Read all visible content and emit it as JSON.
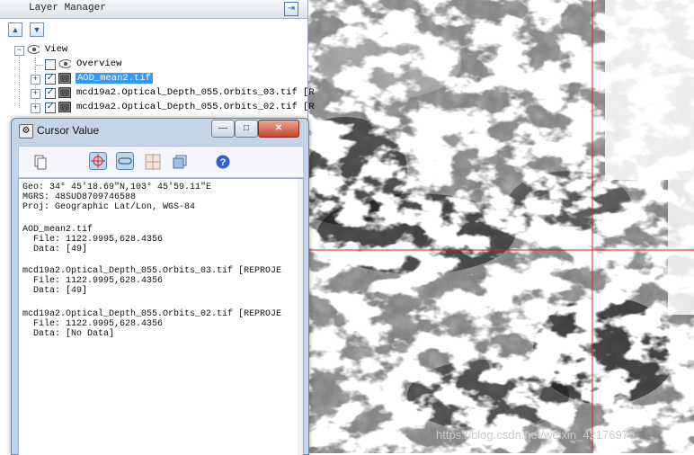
{
  "layer_manager": {
    "title": "Layer Manager",
    "tree": {
      "root": "View",
      "items": [
        {
          "label": "Overview",
          "checked": false
        },
        {
          "label": "AOD_mean2.tif",
          "checked": true,
          "selected": true
        },
        {
          "label": "mcd19a2.Optical_Depth_055.Orbits_03.tif [R",
          "checked": true
        },
        {
          "label": "mcd19a2.Optical_Depth_055.Orbits_02.tif [R",
          "checked": true
        }
      ]
    }
  },
  "cursor_value": {
    "title": "Cursor Value",
    "buttons": {
      "minimize": "—",
      "maximize": "□",
      "close": "✕"
    },
    "header": {
      "geo": "Geo: 34° 45′18.69″N,103° 45′59.11″E",
      "mgrs": "MGRS: 48SUD8709746588",
      "proj": "Proj: Geographic Lat/Lon, WGS-84"
    },
    "layers": [
      {
        "name": "AOD_mean2.tif",
        "file": "  File: 1122.9995,628.4356",
        "data": "  Data: [49]"
      },
      {
        "name": "mcd19a2.Optical_Depth_055.Orbits_03.tif [REPROJE",
        "file": "  File: 1122.9995,628.4356",
        "data": "  Data: [49]"
      },
      {
        "name": "mcd19a2.Optical_Depth_055.Orbits_02.tif [REPROJE",
        "file": "  File: 1122.9995,628.4356",
        "data": "  Data: [No Data]"
      }
    ]
  },
  "watermark": "https://blog.csdn.net/weixin_42176976",
  "colors": {
    "crosshair": "#e0191b",
    "selection": "#3399ff",
    "window_frame": "#c4d5e8"
  }
}
